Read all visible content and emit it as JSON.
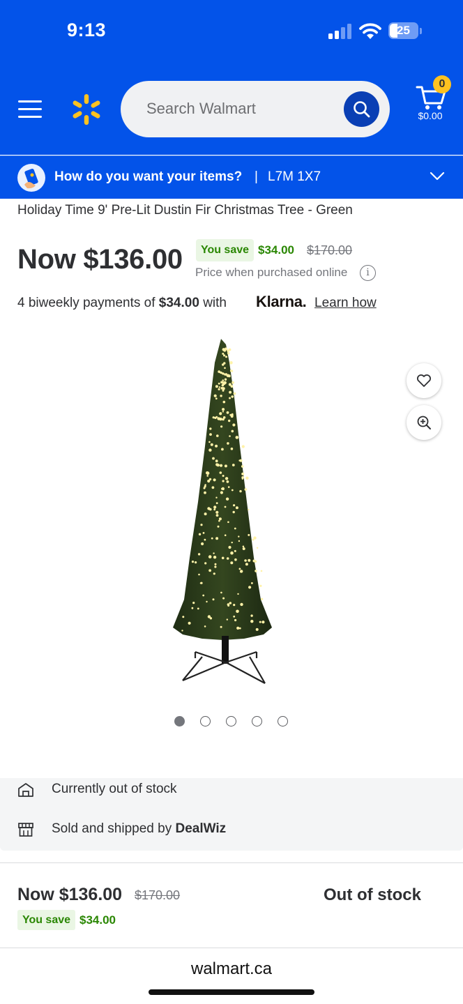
{
  "status_bar": {
    "time": "9:13",
    "battery": "25"
  },
  "header": {
    "search_placeholder": "Search Walmart",
    "cart_count": "0",
    "cart_total": "$0.00",
    "brand_color": "#0353e9",
    "spark_color": "#ffc220"
  },
  "fulfillment": {
    "question": "How do you want your items?",
    "separator": "|",
    "postal_code": "L7M 1X7"
  },
  "product": {
    "title": "Holiday Time 9' Pre-Lit Dustin Fir Christmas Tree - Green",
    "price_now": "Now $136.00",
    "you_save_label": "You save",
    "you_save_amount": "$34.00",
    "was_price": "$170.00",
    "price_note": "Price when purchased online",
    "info_icon_text": "i",
    "image_count": 5,
    "active_image_index": 0
  },
  "klarna": {
    "prefix": "4 biweekly payments of",
    "amount": "$34.00",
    "with": "with",
    "logo": "Klarna.",
    "learn_link": "Learn how"
  },
  "availability": {
    "stock_text": "Currently out of stock",
    "sold_by_prefix": "Sold and shipped by",
    "seller": "DealWiz"
  },
  "bottom_bar": {
    "price": "Now $136.00",
    "was_price": "$170.00",
    "you_save_label": "You save",
    "you_save_amount": "$34.00",
    "status": "Out of stock"
  },
  "browser": {
    "url": "walmart.ca"
  },
  "colors": {
    "save_green": "#2a8703",
    "save_bg": "#eaf6e4",
    "muted": "#74767c"
  }
}
